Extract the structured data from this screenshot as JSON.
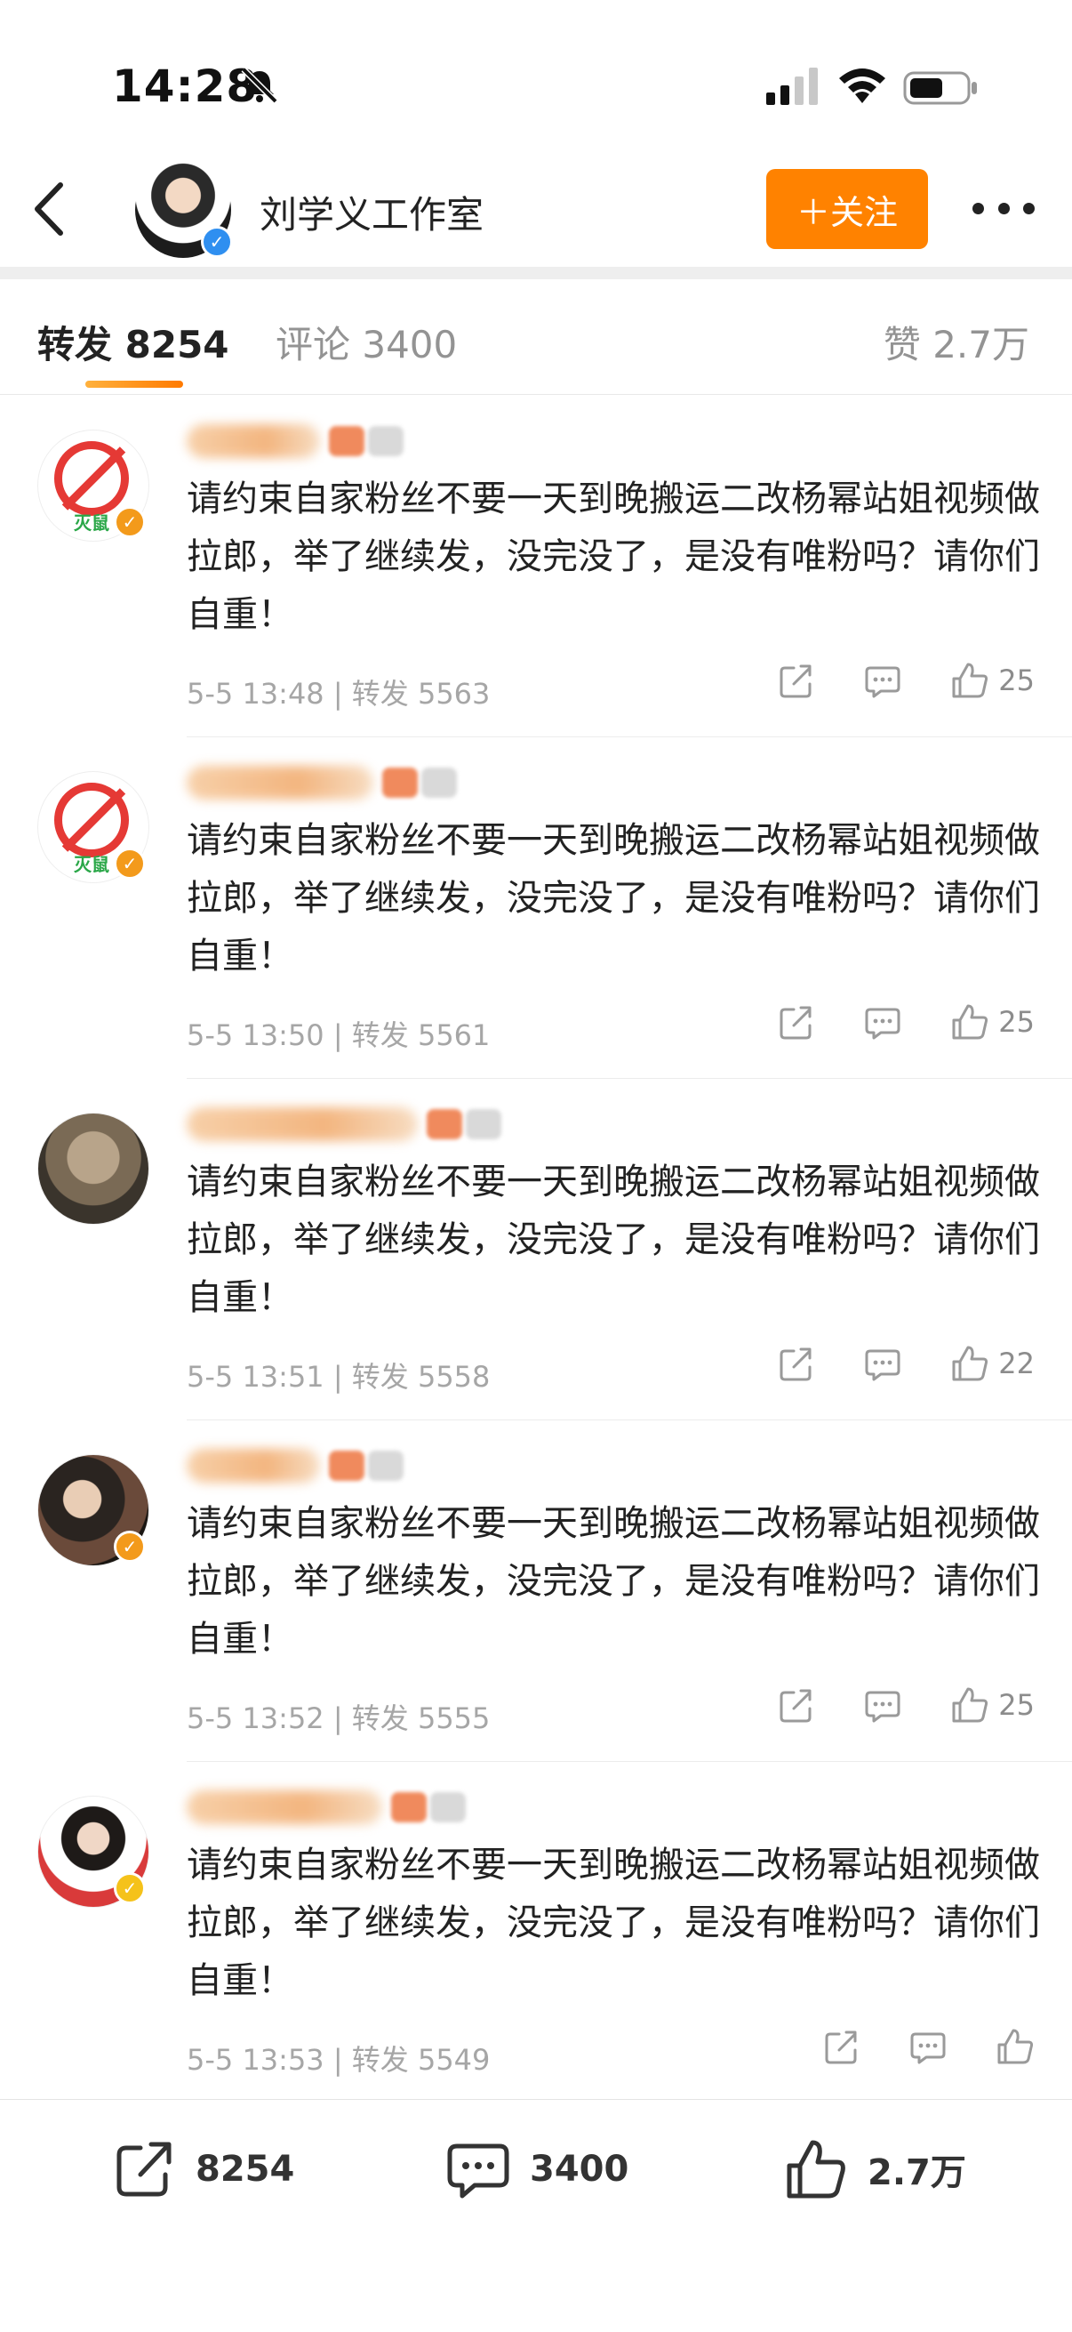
{
  "status_bar": {
    "time": "14:28",
    "icons": [
      "bell-slash-icon",
      "signal-icon",
      "wifi-icon",
      "battery-icon"
    ]
  },
  "nav": {
    "title": "刘学义工作室",
    "follow_label": "＋关注"
  },
  "tabs": {
    "repost": "转发 8254",
    "comment": "评论 3400",
    "likes": "赞 2.7万"
  },
  "reposts": [
    {
      "avatar": "ban",
      "verified": "orange",
      "text": "请约束自家粉丝不要一天到晚搬运二改杨幂站姐视频做拉郎，举了继续发，没完没了，是没有唯粉吗？请你们自重！",
      "meta": "5-5 13:48 | 转发 5563",
      "likes": "25"
    },
    {
      "avatar": "ban",
      "verified": "orange",
      "text": "请约束自家粉丝不要一天到晚搬运二改杨幂站姐视频做拉郎，举了继续发，没完没了，是没有唯粉吗？请你们自重！",
      "meta": "5-5 13:50 | 转发 5561",
      "likes": "25"
    },
    {
      "avatar": "cat",
      "verified": "",
      "text": "请约束自家粉丝不要一天到晚搬运二改杨幂站姐视频做拉郎，举了继续发，没完没了，是没有唯粉吗？请你们自重！",
      "meta": "5-5 13:51 | 转发 5558",
      "likes": "22"
    },
    {
      "avatar": "girl",
      "verified": "orange",
      "text": "请约束自家粉丝不要一天到晚搬运二改杨幂站姐视频做拉郎，举了继续发，没完没了，是没有唯粉吗？请你们自重！",
      "meta": "5-5 13:52 | 转发 5555",
      "likes": "25"
    },
    {
      "avatar": "woman",
      "verified": "yellow",
      "text": "请约束自家粉丝不要一天到晚搬运二改杨幂站姐视频做拉郎，举了继续发，没完没了，是没有唯粉吗？请你们自重！",
      "meta": "5-5 13:53 | 转发 5549",
      "likes": ""
    }
  ],
  "bottom_bar": {
    "repost_count": "8254",
    "comment_count": "3400",
    "like_count": "2.7万"
  },
  "colors": {
    "accent": "#ff8200",
    "verified_blue": "#2f8ff0",
    "verified_orange": "#f39a1b"
  }
}
